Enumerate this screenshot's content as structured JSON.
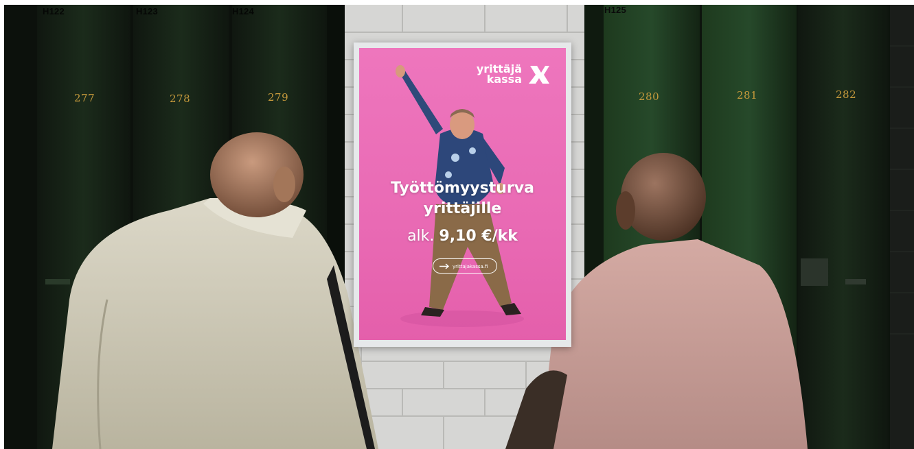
{
  "lockers": {
    "group_labels": [
      "H122",
      "H123",
      "H124",
      "H125"
    ],
    "numbers": [
      "277",
      "278",
      "279",
      "280",
      "281",
      "282"
    ]
  },
  "poster": {
    "brand_line1": "yrittäjä",
    "brand_line2": "kassa",
    "headline_line1": "Työttömyysturva",
    "headline_line2": "yrittäjille",
    "price_prefix": "alk.",
    "price_value": "9,10 €/kk",
    "cta_text": "yrittajakassa.fi",
    "colors": {
      "background": "#ea6cb6",
      "text": "#ffffff"
    }
  },
  "scene": {
    "icons": [
      "arrow-right-icon",
      "yrittajakassa-logo-mark"
    ]
  }
}
